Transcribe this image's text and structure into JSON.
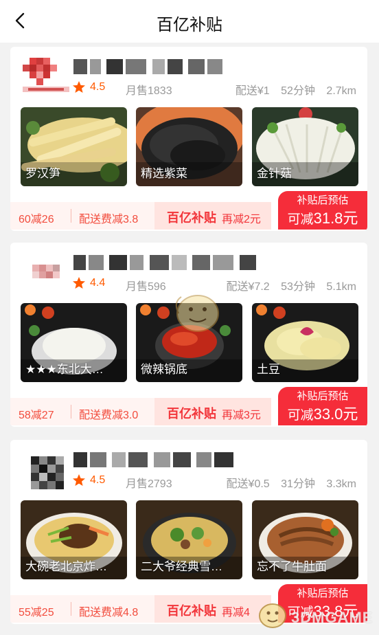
{
  "header": {
    "title": "百亿补贴"
  },
  "colors": {
    "accent": "#f52d3a",
    "orange": "#ff5a00"
  },
  "shops": [
    {
      "name": "",
      "rating": "4.5",
      "monthly_sales": "月售1833",
      "delivery_fee": "配送¥1",
      "delivery_time": "52分钟",
      "distance": "2.7km",
      "dishes": [
        {
          "name": "罗汉笋"
        },
        {
          "name": "精选紫菜"
        },
        {
          "name": "金针菇"
        }
      ],
      "promo": {
        "discount": "60减26",
        "fee_off": "配送费减3.8",
        "brand": "百亿补贴",
        "extra": "再减2元",
        "est_title": "补贴后预估",
        "est_prefix": "可减",
        "est_value": "31.8元"
      }
    },
    {
      "name": "",
      "rating": "4.4",
      "monthly_sales": "月售596",
      "delivery_fee": "配送¥7.2",
      "delivery_time": "53分钟",
      "distance": "5.1km",
      "dishes": [
        {
          "name": "★★★东北大…"
        },
        {
          "name": "微辣锅底"
        },
        {
          "name": "土豆"
        }
      ],
      "promo": {
        "discount": "58减27",
        "fee_off": "配送费减3.0",
        "brand": "百亿补贴",
        "extra": "再减3元",
        "est_title": "补贴后预估",
        "est_prefix": "可减",
        "est_value": "33.0元"
      }
    },
    {
      "name": "",
      "rating": "4.5",
      "monthly_sales": "月售2793",
      "delivery_fee": "配送¥0.5",
      "delivery_time": "31分钟",
      "distance": "3.3km",
      "dishes": [
        {
          "name": "大碗老北京炸…"
        },
        {
          "name": "二大爷经典雪…"
        },
        {
          "name": "忘不了牛肚面"
        }
      ],
      "promo": {
        "discount": "55减25",
        "fee_off": "配送费减4.8",
        "brand": "百亿补贴",
        "extra": "再减4",
        "est_title": "补贴后预估",
        "est_prefix": "可减",
        "est_value": "33.8元"
      }
    }
  ],
  "watermark": {
    "text": "3DMGAME"
  }
}
